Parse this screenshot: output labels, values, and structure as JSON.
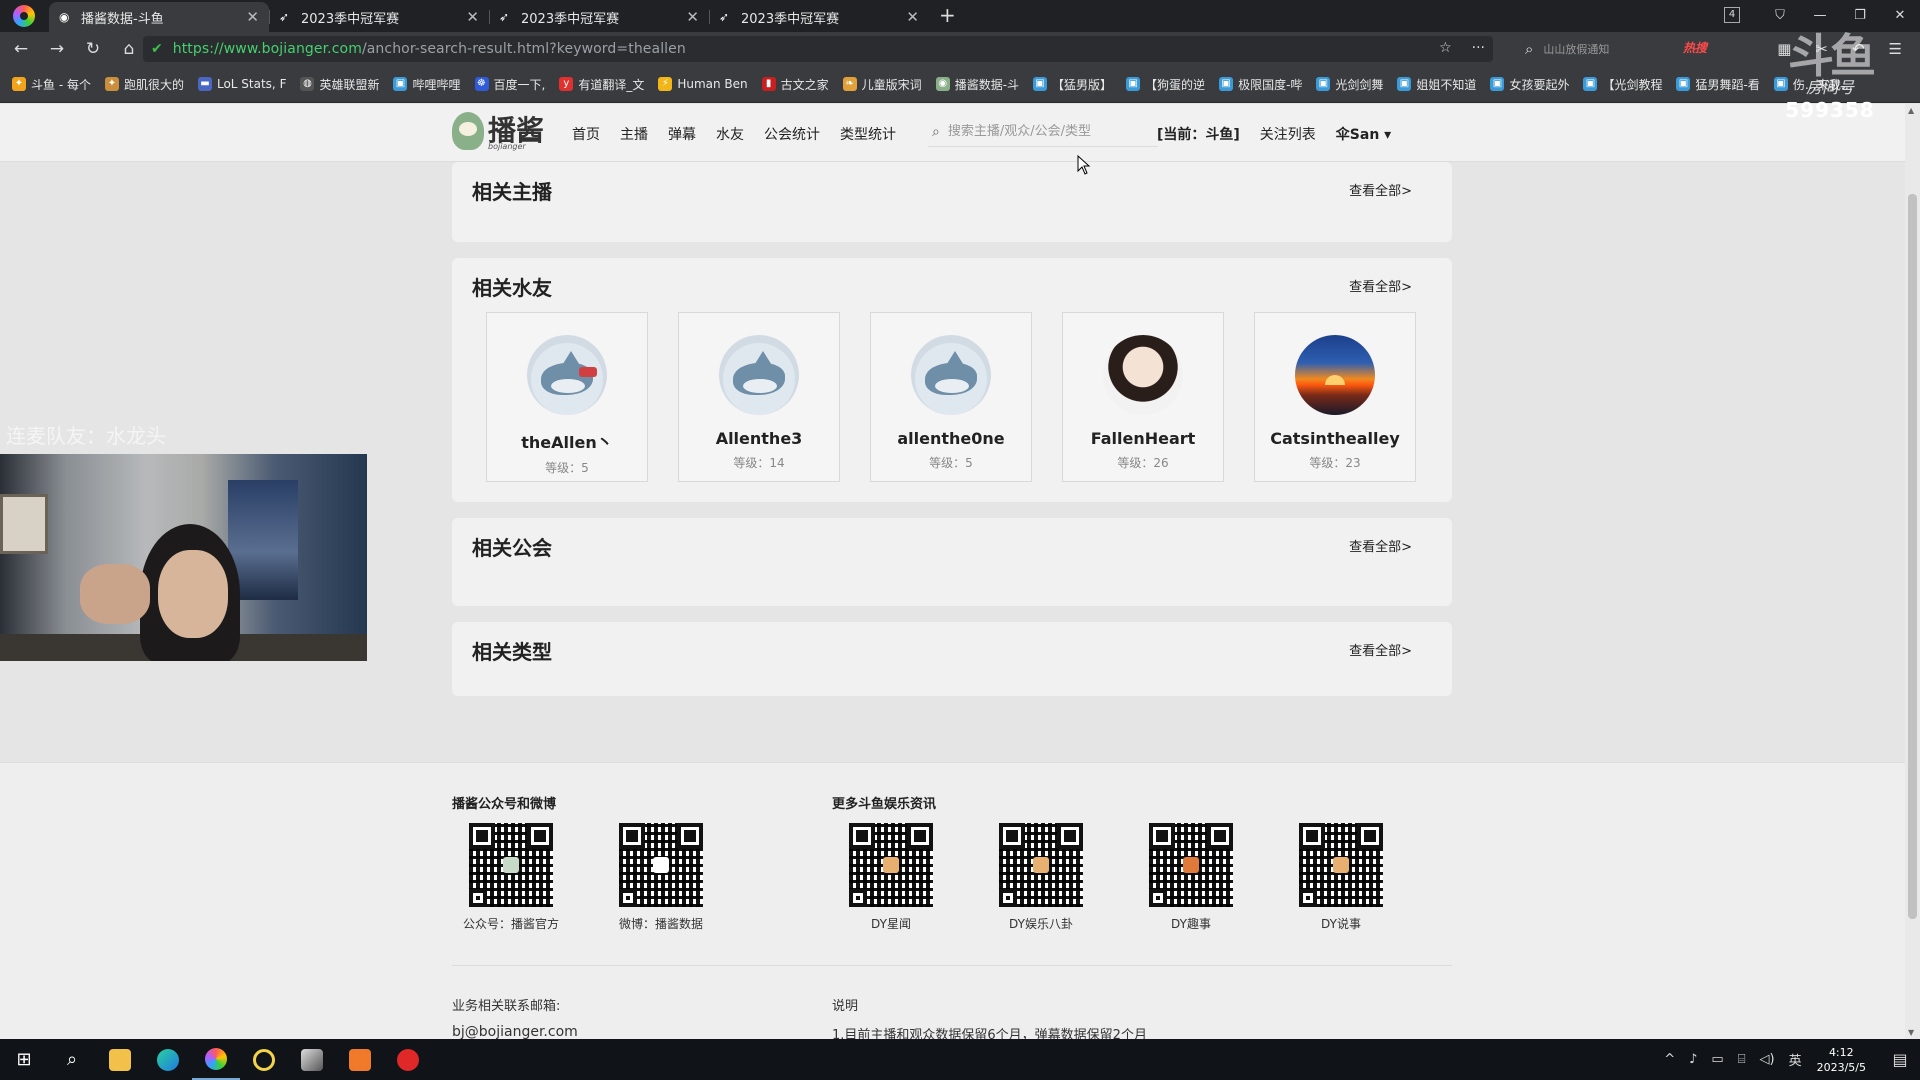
{
  "browser": {
    "tabs": [
      {
        "title": "播酱数据-斗鱼",
        "active": true
      },
      {
        "title": "2023季中冠军赛",
        "active": false
      },
      {
        "title": "2023季中冠军赛",
        "active": false
      },
      {
        "title": "2023季中冠军赛",
        "active": false
      }
    ],
    "tab_count": "4",
    "url_host": "https://www.bojianger.com",
    "url_path": "/anchor-search-result.html?keyword=theallen",
    "search_hint": "山山放假通知",
    "hot_label": "热搜",
    "bookmarks": [
      "斗鱼 - 每个",
      "跑肌很大的",
      "LoL Stats, F",
      "英雄联盟新",
      "哔哩哔哩",
      "百度一下,",
      "有道翻译_文",
      "Human Ben",
      "古文之家",
      "儿童版宋词",
      "播酱数据-斗",
      "【猛男版】",
      "【狗蛋的逆",
      "极限国度-哔",
      "光剑剑舞",
      "姐姐不知道",
      "女孩要起外",
      "【光剑教程",
      "猛男舞蹈-看",
      "伤…来我…"
    ]
  },
  "watermark": {
    "logo": "斗鱼",
    "room_label": "房间号",
    "room_number": "599358"
  },
  "site": {
    "logo_text": "播酱",
    "logo_sub": "bojianger",
    "nav": [
      "首页",
      "主播",
      "弹幕",
      "水友",
      "公会统计",
      "类型统计"
    ],
    "search_placeholder": "搜索主播/观众/公会/类型",
    "platform": "[当前：斗鱼]",
    "follow_list": "关注列表",
    "user": "伞San ▾"
  },
  "sections": {
    "anchors": {
      "title": "相关主播",
      "see_all": "查看全部>"
    },
    "fans": {
      "title": "相关水友",
      "see_all": "查看全部>",
      "items": [
        {
          "name": "theAllen丶",
          "level": "等级：5",
          "avatar": "fish-scarf"
        },
        {
          "name": "Allenthe3",
          "level": "等级：14",
          "avatar": "fish"
        },
        {
          "name": "allenthe0ne",
          "level": "等级：5",
          "avatar": "fish-sitting"
        },
        {
          "name": "FallenHeart",
          "level": "等级：26",
          "avatar": "photo"
        },
        {
          "name": "Catsinthealley",
          "level": "等级：23",
          "avatar": "sunset"
        }
      ]
    },
    "guilds": {
      "title": "相关公会",
      "see_all": "查看全部>"
    },
    "types": {
      "title": "相关类型",
      "see_all": "查看全部>"
    }
  },
  "stream_overlay": {
    "label": "连麦队友：水龙头"
  },
  "footer": {
    "heading_left": "播酱公众号和微博",
    "heading_right": "更多斗鱼娱乐资讯",
    "qr_left": [
      "公众号：播酱官方",
      "微博：播酱数据"
    ],
    "qr_right": [
      "DY星闻",
      "DY娱乐八卦",
      "DY趣事",
      "DY说事"
    ],
    "contact_label": "业务相关联系邮箱:",
    "contact_email": "bj@bojianger.com",
    "note_label": "说明",
    "note_text": "1.目前主播和观众数据保留6个月，弹幕数据保留2个月"
  },
  "taskbar": {
    "ime": "英",
    "time": "4:12",
    "date": "2023/5/5"
  }
}
